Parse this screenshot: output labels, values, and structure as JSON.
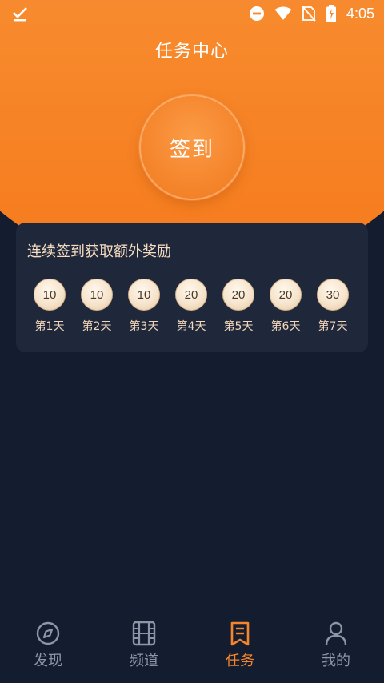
{
  "status_bar": {
    "time": "4:05"
  },
  "header": {
    "title": "任务中心"
  },
  "signin": {
    "label": "签到"
  },
  "reward": {
    "title": "连续签到获取额外奖励",
    "days": [
      {
        "points": "10",
        "label": "第1天"
      },
      {
        "points": "10",
        "label": "第2天"
      },
      {
        "points": "10",
        "label": "第3天"
      },
      {
        "points": "20",
        "label": "第4天"
      },
      {
        "points": "20",
        "label": "第5天"
      },
      {
        "points": "20",
        "label": "第6天"
      },
      {
        "points": "30",
        "label": "第7天"
      }
    ]
  },
  "bottom_nav": {
    "items": [
      {
        "label": "发现",
        "icon": "compass-icon",
        "active": false
      },
      {
        "label": "频道",
        "icon": "film-icon",
        "active": false
      },
      {
        "label": "任务",
        "icon": "task-icon",
        "active": true
      },
      {
        "label": "我的",
        "icon": "user-icon",
        "active": false
      }
    ]
  },
  "colors": {
    "accent": "#f7862a",
    "background": "#141c2f",
    "card": "#1f283b",
    "coin": "#f6e4cd"
  }
}
